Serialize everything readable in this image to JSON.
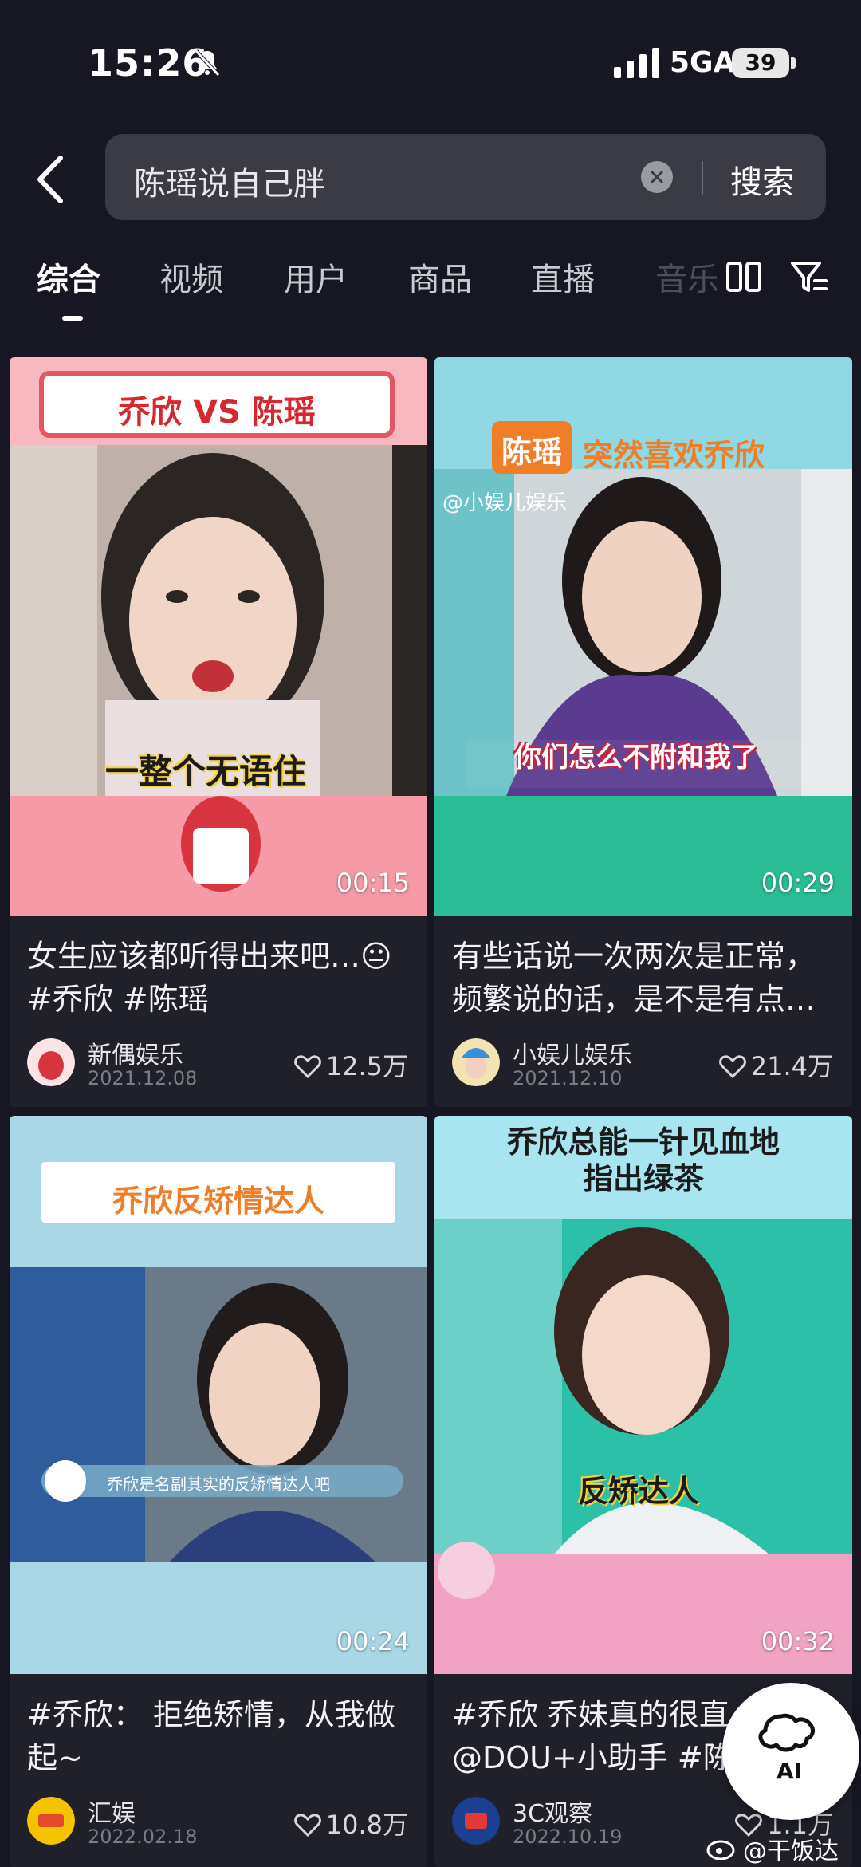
{
  "status": {
    "time": "15:26",
    "network": "5GA",
    "battery": "39"
  },
  "search": {
    "query": "陈瑶说自己胖",
    "button": "搜索"
  },
  "tabs": [
    "综合",
    "视频",
    "用户",
    "商品",
    "直播",
    "音乐"
  ],
  "cards": [
    {
      "duration": "00:15",
      "title": "女生应该都听得出来吧…😐 #乔欣 #陈瑶",
      "author": "新偶娱乐",
      "date": "2021.12.08",
      "likes": "12.5万",
      "banner": "乔欣 VS 陈瑶",
      "caption": "一整个无语住"
    },
    {
      "duration": "00:29",
      "title": "有些话说一次两次是正常，频繁说的话，是不是有点…",
      "author": "小娱儿娱乐",
      "date": "2021.12.10",
      "likes": "21.4万",
      "banner_name": "陈瑶",
      "banner": "突然喜欢乔欣",
      "watermark": "@小娱儿娱乐",
      "caption": "你们怎么不附和我了"
    },
    {
      "duration": "00:24",
      "title": "#乔欣： 拒绝矫情，从我做起~",
      "author": "汇娱",
      "date": "2022.02.18",
      "likes": "10.8万",
      "banner": "乔欣反矫情达人",
      "subtitle": "乔欣是名副其实的反矫情达人吧"
    },
    {
      "duration": "00:32",
      "title": "#乔欣 乔妹真的很直 @DOU+小助手 #陈瑶",
      "author": "3C观察",
      "date": "2022.10.19",
      "likes": "1.1万",
      "banner_line1": "乔欣总能一针见血地",
      "banner_line2": "指出绿茶",
      "caption": "反矫达人"
    }
  ],
  "ai_button": "AI",
  "watermark": "@干饭达子"
}
